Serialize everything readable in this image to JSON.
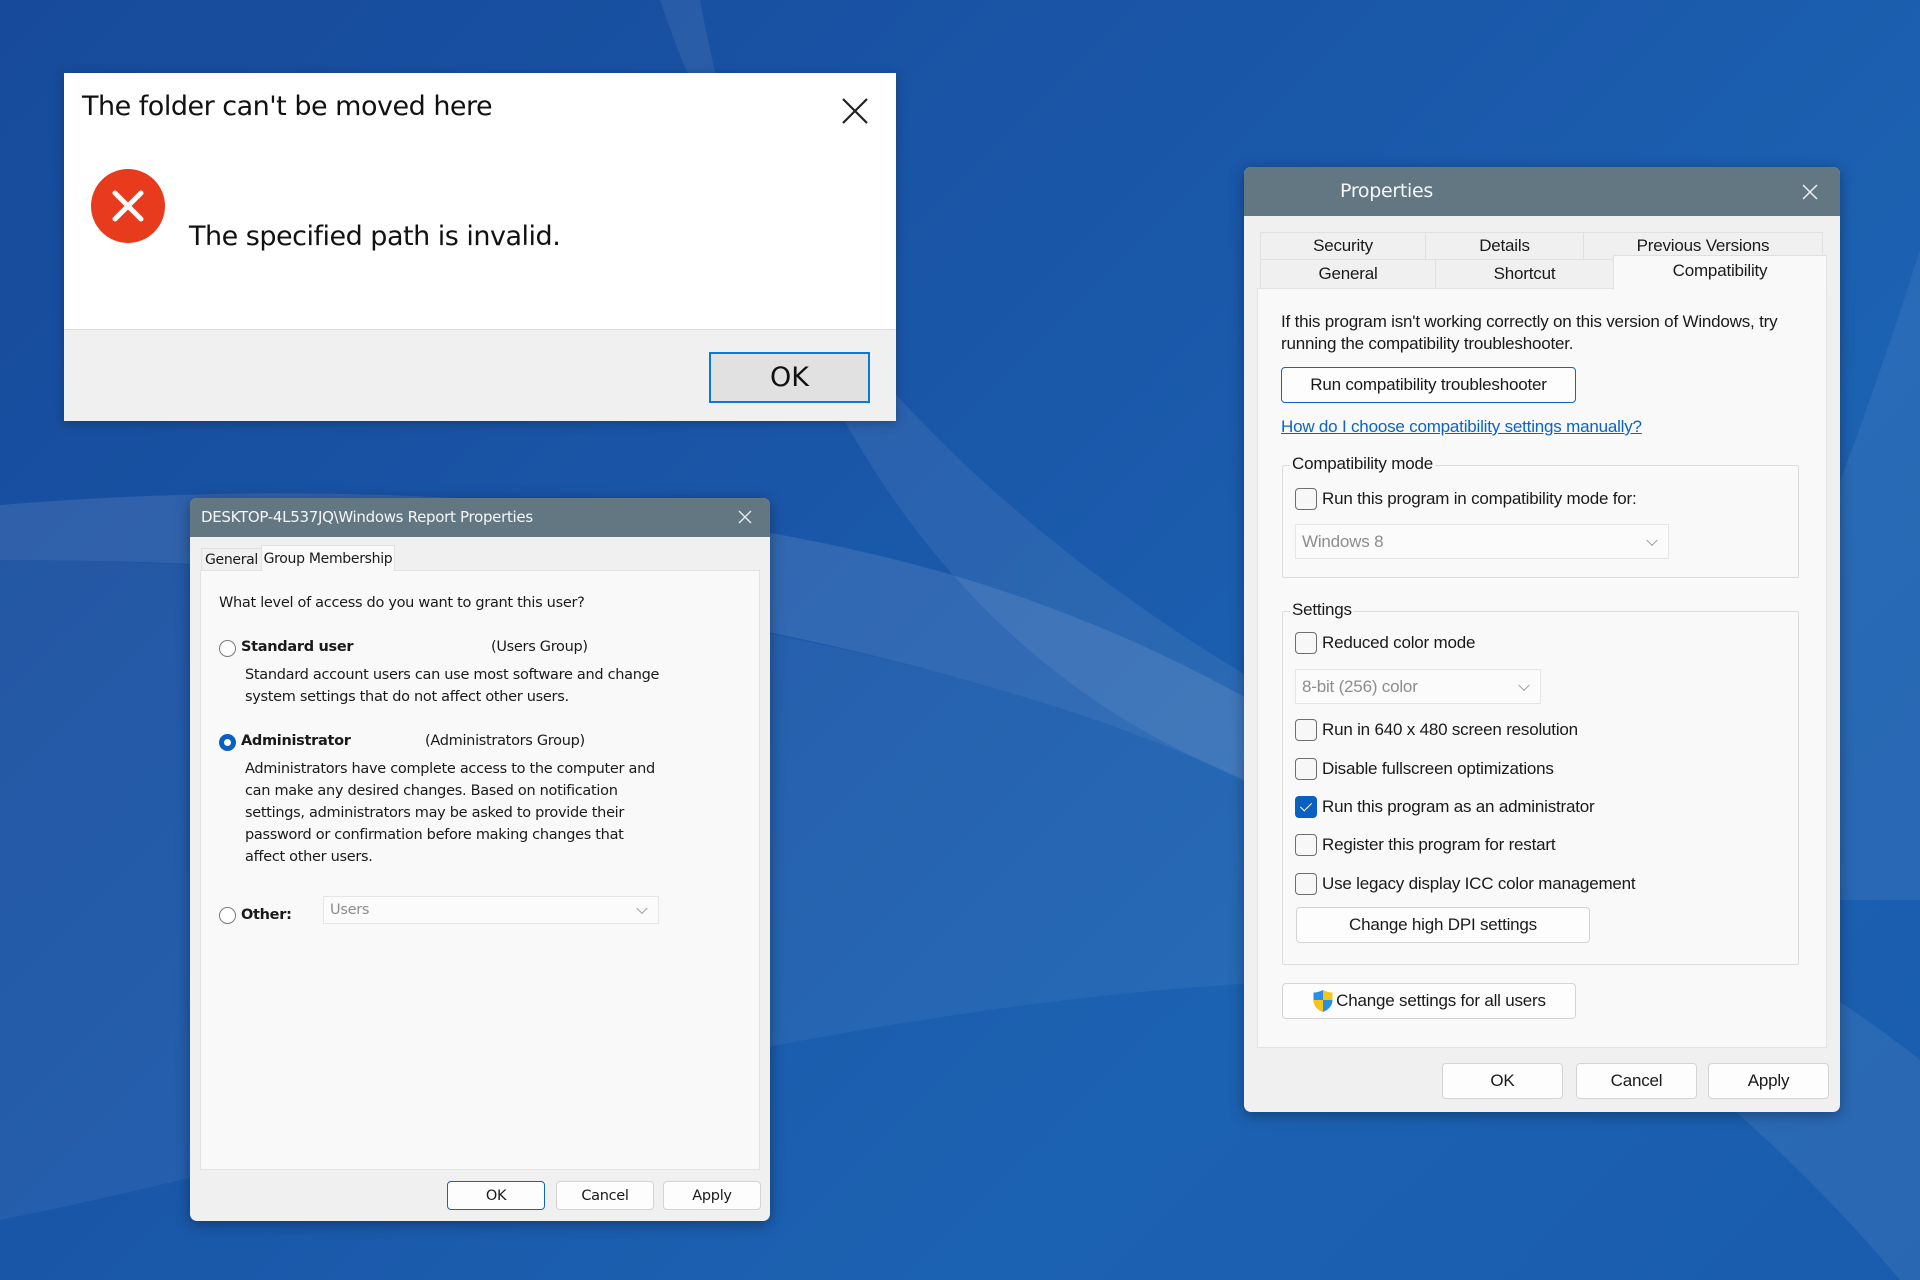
{
  "error_dialog": {
    "title": "The folder can't be moved here",
    "icon": "error-icon",
    "message": "The specified path is invalid.",
    "ok_label": "OK",
    "close_icon": "close-icon",
    "colors": {
      "icon": "#e83a1c",
      "ok_border": "#0a78d7"
    }
  },
  "user_dialog": {
    "title": "DESKTOP-4L537JQ\\Windows Report Properties",
    "tabs": [
      {
        "label": "General",
        "selected": false
      },
      {
        "label": "Group Membership",
        "selected": true
      }
    ],
    "question": "What level of access do you want to grant this user?",
    "options": [
      {
        "label": "Standard user",
        "group": "(Users Group)",
        "selected": false,
        "description": [
          "Standard account users can use most software and change",
          "system settings that do not affect other users."
        ]
      },
      {
        "label": "Administrator",
        "group": "(Administrators Group)",
        "selected": true,
        "description": [
          "Administrators have complete access to the computer and",
          "can make any desired changes. Based on notification",
          "settings, administrators may be asked to provide their",
          "password or confirmation before making changes that",
          "affect other users."
        ]
      },
      {
        "label": "Other:",
        "selected": false,
        "dropdown_value": "Users"
      }
    ],
    "buttons": {
      "ok": "OK",
      "cancel": "Cancel",
      "apply": "Apply"
    }
  },
  "properties_dialog": {
    "title": "Properties",
    "tabs_row1": [
      "Security",
      "Details",
      "Previous Versions"
    ],
    "tabs_row2": [
      "General",
      "Shortcut",
      "Compatibility"
    ],
    "selected_tab": "Compatibility",
    "intro_lines": [
      "If this program isn't working correctly on this version of Windows, try",
      "running the compatibility troubleshooter."
    ],
    "troubleshooter_button": "Run compatibility troubleshooter",
    "help_link": "How do I choose compatibility settings manually?",
    "compat_mode": {
      "group_label": "Compatibility mode",
      "checkbox_label": "Run this program in compatibility mode for:",
      "checked": false,
      "dropdown_value": "Windows 8"
    },
    "settings": {
      "group_label": "Settings",
      "reduced_color": {
        "label": "Reduced color mode",
        "checked": false
      },
      "color_dropdown_value": "8-bit (256) color",
      "options": [
        {
          "label": "Run in 640 x 480 screen resolution",
          "checked": false
        },
        {
          "label": "Disable fullscreen optimizations",
          "checked": false
        },
        {
          "label": "Run this program as an administrator",
          "checked": true
        },
        {
          "label": "Register this program for restart",
          "checked": false
        },
        {
          "label": "Use legacy display ICC color management",
          "checked": false
        }
      ],
      "dpi_button": "Change high DPI settings"
    },
    "all_users_button": "Change settings for all users",
    "all_users_icon": "uac-shield-icon",
    "buttons": {
      "ok": "OK",
      "cancel": "Cancel",
      "apply": "Apply"
    },
    "colors": {
      "titlebar": "#637782",
      "checkbox_checked": "#0a5fc2",
      "link": "#0a64c6"
    }
  }
}
